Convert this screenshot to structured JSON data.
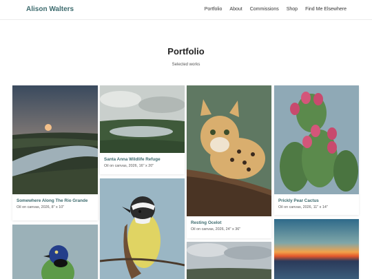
{
  "header": {
    "brand": "Alison Walters",
    "nav": [
      "Portfolio",
      "About",
      "Commissions",
      "Shop",
      "Find Me Elsewhere"
    ]
  },
  "main": {
    "title": "Portfolio",
    "subtitle": "Selected works"
  },
  "works": [
    {
      "title": "Somewhere Along The Rio Grande",
      "meta": "Oil on canvas, 2026, 8\" x 10\""
    },
    {
      "title": "Santa Anna Wildlife Refuge",
      "meta": "Oil on canvas, 2026, 16\" x 20\""
    },
    {
      "title": "Resting Ocelot",
      "meta": "Oil on canvas, 2026, 24\" x 36\""
    },
    {
      "title": "Prickly Pear Cactus",
      "meta": "Oil on canvas, 2026, 11\" x 14\""
    }
  ],
  "colors": {
    "accent": "#3d6b6e"
  }
}
